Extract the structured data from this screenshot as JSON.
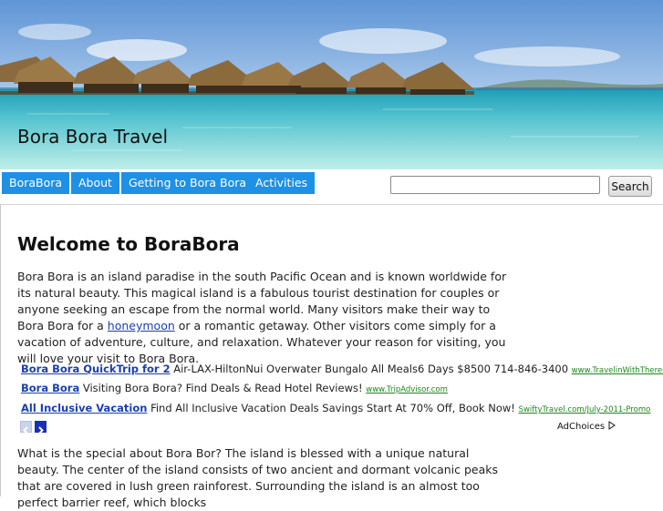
{
  "site": {
    "title": "Bora Bora Travel"
  },
  "nav": {
    "items": [
      {
        "label": "BoraBora"
      },
      {
        "label": "About"
      },
      {
        "label": "Getting to Bora Bora"
      },
      {
        "label": "Activities"
      }
    ],
    "accent_color": "#1e90e6"
  },
  "search": {
    "value": "",
    "button_label": "Search"
  },
  "main": {
    "heading": "Welcome to BoraBora",
    "para1_before": "Bora Bora is an island paradise in the south Pacific Ocean and is known worldwide for its natural beauty. This magical island is a fabulous tourist destination for couples or anyone seeking an escape from the normal world. Many visitors make their way to Bora Bora for a ",
    "para1_link": "honeymoon",
    "para1_after": " or a romantic getaway. Other visitors come simply for a vacation of adventure, culture, and relaxation. Whatever your reason for visiting, you will love your visit to Bora Bora.",
    "para2": "What is the special about Bora Bor? The island is blessed with a unique natural beauty. The center of the island consists of two ancient and dormant volcanic peaks that are covered in lush green rainforest. Surrounding the island is an almost too perfect barrier reef, which blocks"
  },
  "ads": {
    "items": [
      {
        "title": "Bora Bora QuickTrip for 2",
        "text": " Air-LAX-HiltonNui Overwater Bungalo All Meals6 Days $8500 714-846-3400 ",
        "url": "www.TravelinWithTheresa"
      },
      {
        "title": "Bora Bora",
        "text": " Visiting Bora Bora? Find Deals & Read Hotel Reviews! ",
        "url": "www.TripAdvisor.com"
      },
      {
        "title": "All Inclusive Vacation",
        "text": " Find All Inclusive Vacation Deals Savings Start At 70% Off, Book Now! ",
        "url": "SwiftyTravel.com/July-2011-Promo"
      }
    ],
    "choices_label": "AdChoices",
    "prev_icon": "chevron-left-icon",
    "next_icon": "chevron-right-icon"
  }
}
